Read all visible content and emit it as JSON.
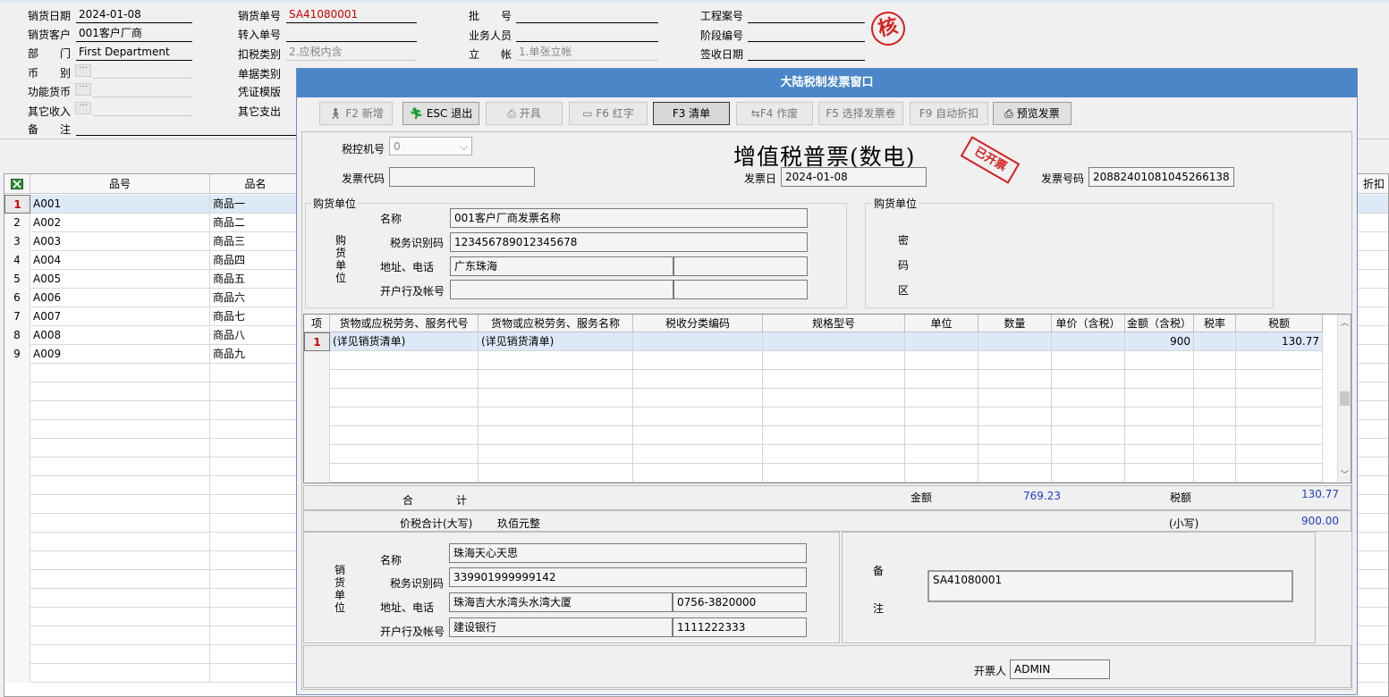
{
  "header": {
    "sale_date_label": "销货日期",
    "sale_date": "2024-01-08",
    "customer_label": "销货客户",
    "customer": "001客户厂商",
    "dept_label": "部　　门",
    "dept": "First Department",
    "currency_label": "币　　别",
    "func_currency_label": "功能货币",
    "other_income_label": "其它收入",
    "remark_label": "备　　注",
    "sale_no_label": "销货单号",
    "sale_no": "SA41080001",
    "transfer_no_label": "转入单号",
    "tax_type_label": "扣税类别",
    "tax_type": "2.应税内含",
    "doc_type_label": "单据类别",
    "voucher_tpl_label": "凭证模版",
    "other_expense_label": "其它支出",
    "batch_label": "批　　号",
    "salesman_label": "业务人员",
    "account_label": "立　　帐",
    "account": "1.单张立帐",
    "project_label": "工程案号",
    "phase_label": "阶段编号",
    "sign_date_label": "签收日期",
    "stamp_text": "核"
  },
  "grid": {
    "columns": [
      "品号",
      "品名"
    ],
    "right_col": "折扣",
    "rows": [
      {
        "n": "1",
        "code": "A001",
        "name": "商品一"
      },
      {
        "n": "2",
        "code": "A002",
        "name": "商品二"
      },
      {
        "n": "3",
        "code": "A003",
        "name": "商品三"
      },
      {
        "n": "4",
        "code": "A004",
        "name": "商品四"
      },
      {
        "n": "5",
        "code": "A005",
        "name": "商品五"
      },
      {
        "n": "6",
        "code": "A006",
        "name": "商品六"
      },
      {
        "n": "7",
        "code": "A007",
        "name": "商品七"
      },
      {
        "n": "8",
        "code": "A008",
        "name": "商品八"
      },
      {
        "n": "9",
        "code": "A009",
        "name": "商品九"
      }
    ]
  },
  "dialog": {
    "title": "大陆税制发票窗口",
    "toolbar": {
      "new": "F2 新增",
      "exit": "ESC 退出",
      "issue": "开具",
      "red": "F6 红字",
      "list": "F3 清单",
      "void": "F4 作废",
      "select_roll": "F5 选择发票卷",
      "auto_discount": "F9 自动折扣",
      "preview": "预览发票"
    },
    "tax_machine_label": "税控机号",
    "tax_machine": "0",
    "invoice_code_label": "发票代码",
    "invoice_title": "增值税普票(数电)",
    "issued_stamp": "已开票",
    "invoice_date_label": "发票日",
    "invoice_date": "2024-01-08",
    "invoice_no_label": "发票号码",
    "invoice_no": "20882401081045266138",
    "buyer": {
      "group_label": "购货单位",
      "side_label": "购货单位",
      "name_label": "名称",
      "name": "001客户厂商发票名称",
      "tax_id_label": "税务识别码",
      "tax_id": "123456789012345678",
      "addr_label": "地址、电话",
      "addr": "广东珠海",
      "bank_label": "开户行及帐号"
    },
    "cipher": {
      "group_label": "购货单位",
      "c1": "密",
      "c2": "码",
      "c3": "区"
    },
    "lines": {
      "columns": [
        "项",
        "货物或应税劳务、服务代号",
        "货物或应税劳务、服务名称",
        "税收分类编码",
        "规格型号",
        "单位",
        "数量",
        "单价（含税）",
        "金额（含税）",
        "税率",
        "税额"
      ],
      "rows": [
        {
          "n": "1",
          "code": "(详见销货清单)",
          "name": "(详见销货清单)",
          "amount": "900",
          "tax": "130.77"
        }
      ]
    },
    "totals": {
      "total_label": "合　　　　计",
      "amount_label": "金额",
      "amount": "769.23",
      "tax_label": "税额",
      "tax": "130.77",
      "sum_big_label": "价税合计(大写)",
      "sum_big": "玖佰元整",
      "sum_small_label": "(小写)",
      "sum_small": "900.00"
    },
    "seller": {
      "side_label": "销货单位",
      "name_label": "名称",
      "name": "珠海天心天思",
      "tax_id_label": "税务识别码",
      "tax_id": "339901999999142",
      "addr_label": "地址、电话",
      "addr": "珠海吉大水湾头水湾大厦",
      "phone": "0756-3820000",
      "bank_label": "开户行及帐号",
      "bank": "建设银行",
      "account": "1111222333"
    },
    "remark": {
      "label1": "备",
      "label2": "注",
      "value": "SA41080001"
    },
    "issuer_label": "开票人",
    "issuer": "ADMIN"
  }
}
